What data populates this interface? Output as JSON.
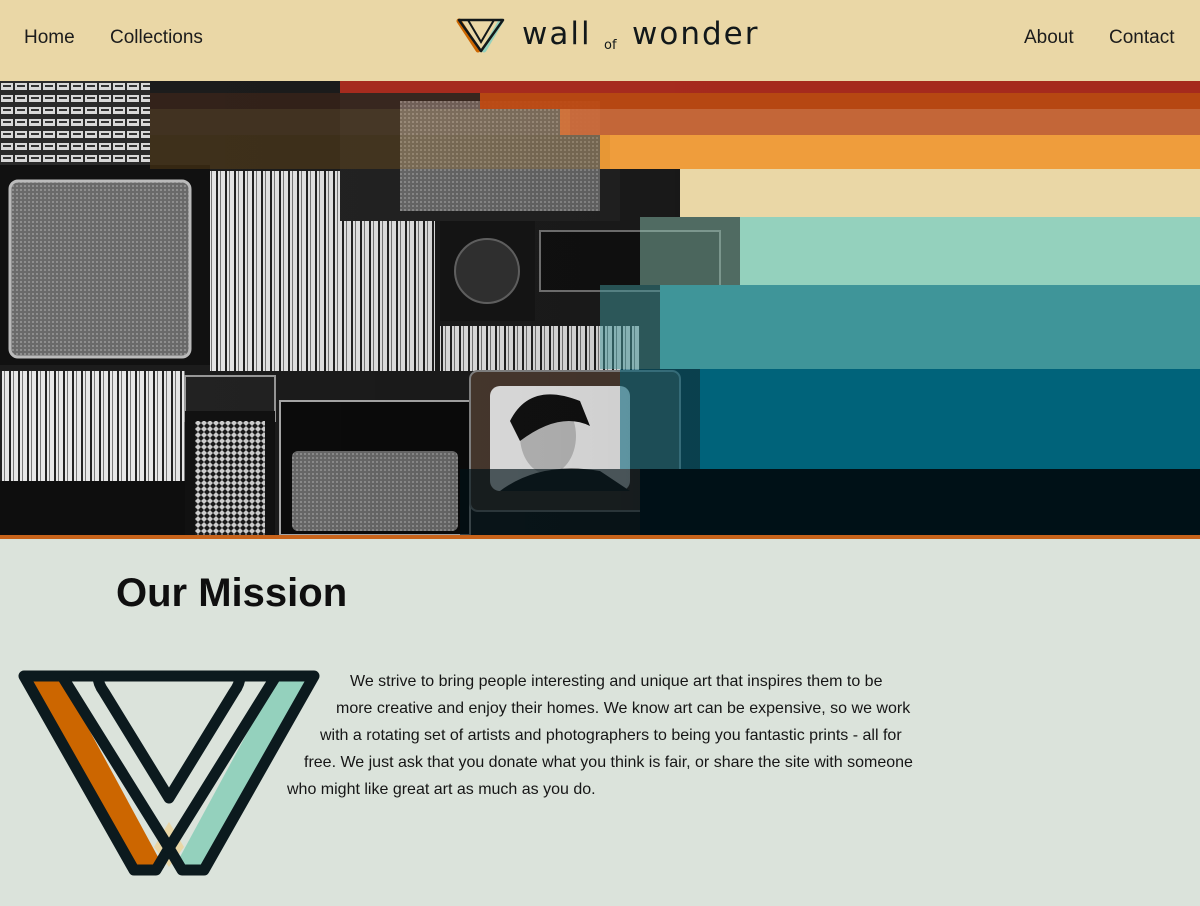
{
  "nav": {
    "left_links": [
      "Home",
      "Collections"
    ],
    "right_links": [
      "About",
      "Contact"
    ],
    "brand": {
      "word1": "wall",
      "word2": "of",
      "word3": "wonder"
    }
  },
  "hero": {
    "stripe_colors": [
      "#b22d1e",
      "#bf4a12",
      "#cc6a3a",
      "#ef9d3c",
      "#ead7a6",
      "#94d1bd",
      "#3f9599",
      "#00637a",
      "#001117"
    ],
    "border_color": "#c8631a"
  },
  "mission": {
    "title": "Our Mission",
    "lines": [
      "We strive to bring people interesting and unique art that inspires them to be",
      "more creative and enjoy their homes. We know art can be expensive, so we work",
      "with a rotating set of artists and photographers to being you fantastic prints - all for",
      "free. We just ask that you donate what you think is fair, or share the site with someone",
      "who might like great art as much as you do."
    ]
  },
  "colors": {
    "nav_bg": "#ead7a6",
    "page_bg": "#dbe3db",
    "accent_orange": "#cc6600",
    "accent_mint": "#94d1bd",
    "dark": "#0c1a1e"
  }
}
